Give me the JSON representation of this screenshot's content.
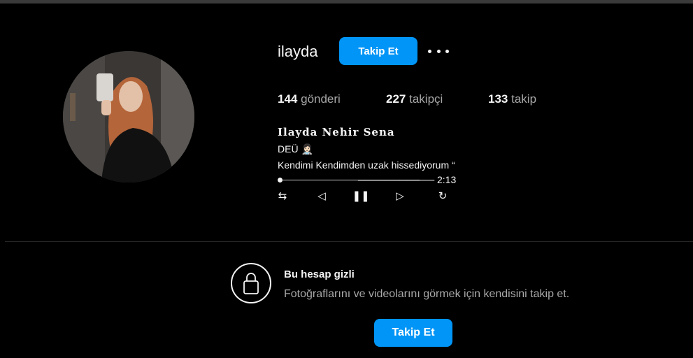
{
  "profile": {
    "username": "ilayda",
    "follow_label": "Takip Et",
    "more_icon": "ellipsis-horizontal-icon",
    "avatar_icon": "profile-photo"
  },
  "stats": {
    "posts_count": "144",
    "posts_label": "gönderi",
    "followers_count": "227",
    "followers_label": "takipçi",
    "following_count": "133",
    "following_label": "takip"
  },
  "bio": {
    "full_name": "Ilayda Nehir Sena",
    "line1": "DEÜ 👩🏻‍⚕️",
    "line2": "Kendimi Kendimden uzak hissediyorum “",
    "line3": "─────────── 2:13"
  },
  "player": {
    "progress": 0,
    "shuffle": "⇆",
    "prev": "◁",
    "pause": "❚❚",
    "next": "▷",
    "repeat": "↻"
  },
  "private": {
    "icon": "lock-icon",
    "title": "Bu hesap gizli",
    "description": "Fotoğraflarını ve videolarını görmek için kendisini takip et.",
    "follow_label": "Takip Et"
  },
  "colors": {
    "background": "#000000",
    "accent": "#0095f6",
    "text_primary": "#f5f5f5",
    "text_secondary": "#a8a8a8",
    "divider": "#262626"
  }
}
